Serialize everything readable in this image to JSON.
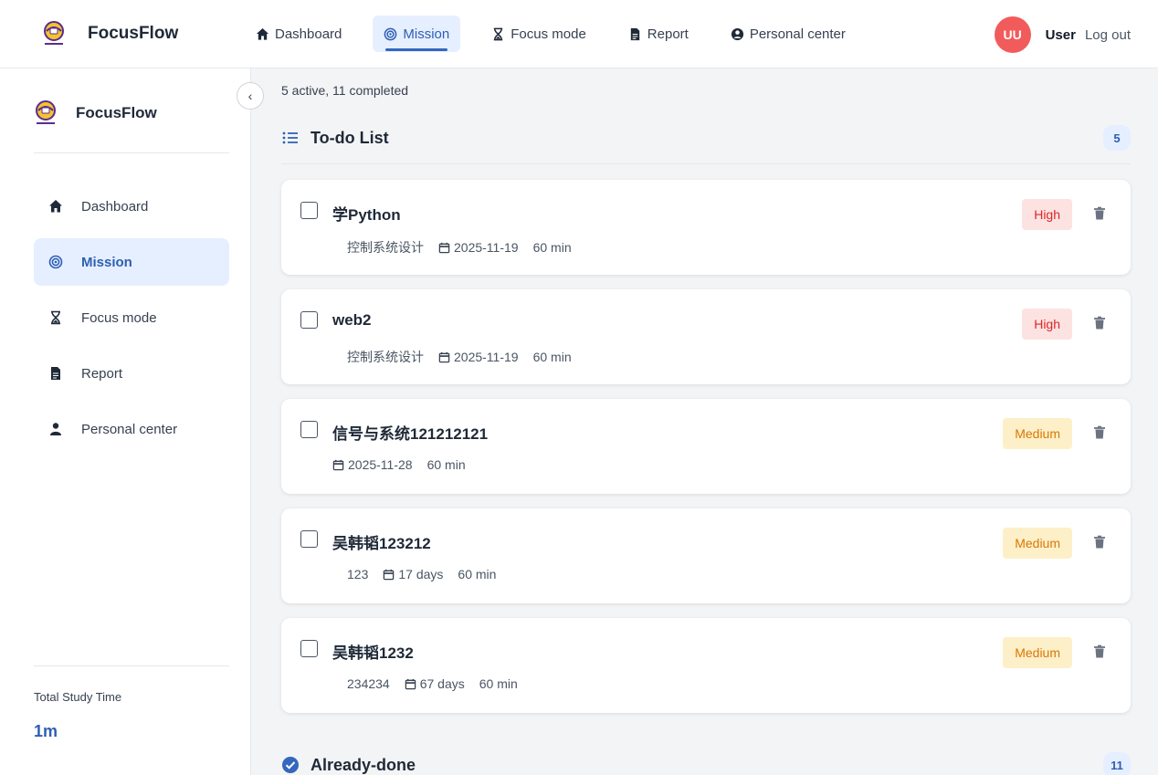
{
  "app": {
    "name": "FocusFlow"
  },
  "topnav": {
    "items": [
      {
        "label": "Dashboard",
        "icon": "home-icon",
        "active": false
      },
      {
        "label": "Mission",
        "icon": "target-icon",
        "active": true
      },
      {
        "label": "Focus mode",
        "icon": "hourglass-icon",
        "active": false
      },
      {
        "label": "Report",
        "icon": "document-icon",
        "active": false
      },
      {
        "label": "Personal center",
        "icon": "user-circle-icon",
        "active": false
      }
    ],
    "user": {
      "initials": "UU",
      "name": "User",
      "logout": "Log out",
      "avatar_color": "#f25b5b"
    }
  },
  "sidebar": {
    "brand": "FocusFlow",
    "collapse_glyph": "‹",
    "items": [
      {
        "label": "Dashboard",
        "icon": "home-icon",
        "active": false
      },
      {
        "label": "Mission",
        "icon": "target-icon",
        "active": true
      },
      {
        "label": "Focus mode",
        "icon": "hourglass-icon",
        "active": false
      },
      {
        "label": "Report",
        "icon": "document-icon",
        "active": false
      },
      {
        "label": "Personal center",
        "icon": "user-icon",
        "active": false
      }
    ],
    "study_label": "Total Study Time",
    "study_value": "1m"
  },
  "main": {
    "summary": "5 active, 11 completed",
    "todo": {
      "title": "To-do List",
      "count": "5",
      "tasks": [
        {
          "title": "学Python",
          "category": "控制系统设计",
          "date": "2025-11-19",
          "duration": "60 min",
          "priority": "High",
          "level": "high"
        },
        {
          "title": "web2",
          "category": "控制系统设计",
          "date": "2025-11-19",
          "duration": "60 min",
          "priority": "High",
          "level": "high"
        },
        {
          "title": "信号与系统121212121",
          "category": "",
          "date": "2025-11-28",
          "duration": "60 min",
          "priority": "Medium",
          "level": "medium"
        },
        {
          "title": "吴韩韬123212",
          "category": "123",
          "date": "17 days",
          "duration": "60 min",
          "priority": "Medium",
          "level": "medium"
        },
        {
          "title": "吴韩韬1232",
          "category": "234234",
          "date": "67 days",
          "duration": "60 min",
          "priority": "Medium",
          "level": "medium"
        }
      ]
    },
    "done": {
      "title": "Already-done",
      "count": "11"
    }
  },
  "colors": {
    "accent": "#2d5fb3",
    "accent_bg": "#e6efff",
    "high_bg": "#fde2e2",
    "high_fg": "#dc2626",
    "medium_bg": "#fdf0c8",
    "medium_fg": "#d97706"
  }
}
